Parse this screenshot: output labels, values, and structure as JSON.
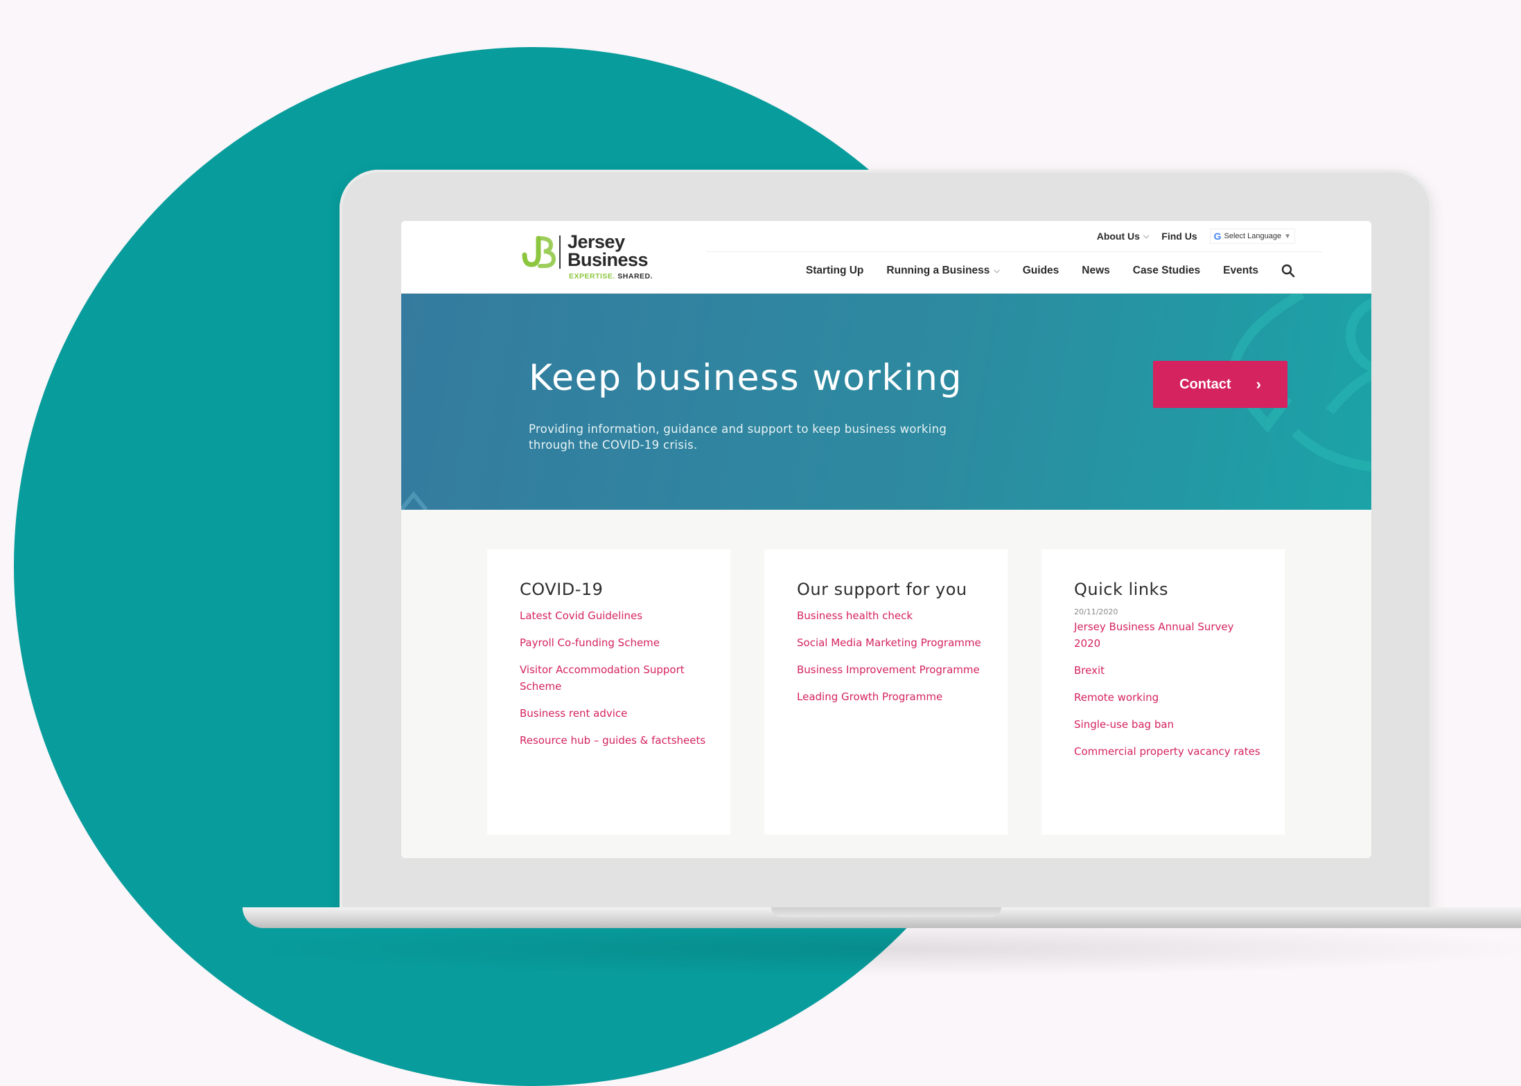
{
  "colors": {
    "background": "#faf6f9",
    "circle_teal": "#089c9c",
    "brand_pink": "#d4235f",
    "brand_green": "#8cc63f",
    "hero_start": "#357b9f",
    "hero_end": "#1ba3a7"
  },
  "logo": {
    "word1": "Jersey",
    "word2": "Business",
    "tagline_a": "EXPERTISE.",
    "tagline_b": "SHARED."
  },
  "util_nav": {
    "about": "About Us",
    "find": "Find Us",
    "language": "Select Language",
    "language_arrow": "▼"
  },
  "main_nav": {
    "items": [
      "Starting Up",
      "Running a Business",
      "Guides",
      "News",
      "Case Studies",
      "Events"
    ],
    "search_icon": "search-icon"
  },
  "hero": {
    "title": "Keep business working",
    "subtitle": "Providing information, guidance and support to keep business working through the COVID-19 crisis.",
    "cta": "Contact"
  },
  "cards": [
    {
      "title": "COVID-19",
      "links": [
        "Latest Covid Guidelines",
        "Payroll Co-funding Scheme",
        "Visitor Accommodation Support Scheme",
        "Business rent advice",
        "Resource hub – guides & factsheets"
      ]
    },
    {
      "title": "Our support for you",
      "links": [
        "Business health check",
        "Social Media Marketing Programme",
        "Business Improvement Programme",
        "Leading Growth Programme"
      ]
    },
    {
      "title": "Quick links",
      "date": "20/11/2020",
      "links": [
        "Jersey Business Annual Survey 2020",
        "Brexit",
        "Remote working",
        "Single-use bag ban",
        "Commercial property vacancy rates"
      ]
    }
  ]
}
